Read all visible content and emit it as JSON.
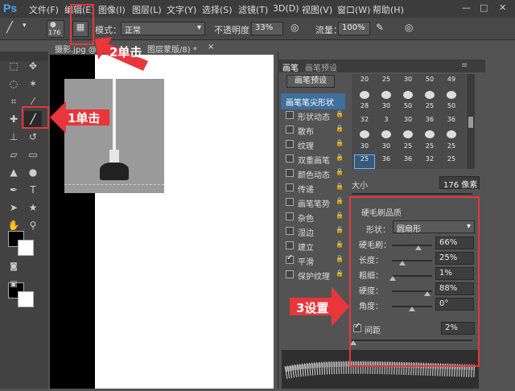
{
  "app": {
    "logo": "Ps"
  },
  "menubar": {
    "items": [
      "文件(F)",
      "编辑(E)",
      "图像(I)",
      "图层(L)",
      "文字(Y)",
      "选择(S)",
      "滤镜(T)",
      "3D(D)",
      "视图(V)",
      "窗口(W)",
      "帮助(H)"
    ],
    "window_controls": [
      "—",
      "□",
      "✕"
    ]
  },
  "options_bar": {
    "brush_size": "176",
    "mode_label": "模式：",
    "mode_value": "正常",
    "opacity_label": "不透明度：",
    "opacity_value": "33%",
    "flow_label": "流量：",
    "flow_value": "100%"
  },
  "document_tab": {
    "title": "摄影.jpg @ 3",
    "title_tail": "图层蒙版/8) *",
    "close": "×"
  },
  "panel": {
    "tabs": [
      "画笔",
      "画笔预设"
    ],
    "preset_button": "画笔预设",
    "options": [
      {
        "label": "画笔笔尖形状",
        "checked": null,
        "selected": true
      },
      {
        "label": "形状动态",
        "checked": false
      },
      {
        "label": "散布",
        "checked": false
      },
      {
        "label": "纹理",
        "checked": false
      },
      {
        "label": "双重画笔",
        "checked": false
      },
      {
        "label": "颜色动态",
        "checked": false
      },
      {
        "label": "传递",
        "checked": false
      },
      {
        "label": "画笔笔势",
        "checked": false
      },
      {
        "label": "杂色",
        "checked": false
      },
      {
        "label": "湿边",
        "checked": false
      },
      {
        "label": "建立",
        "checked": false
      },
      {
        "label": "平滑",
        "checked": true
      },
      {
        "label": "保护纹理",
        "checked": false
      }
    ],
    "brush_sizes": [
      [
        "20",
        "25",
        "30",
        "50",
        "49"
      ],
      [
        "",
        "",
        "",
        "",
        ""
      ],
      [
        "28",
        "30",
        "50",
        "25",
        "50"
      ],
      [
        "32",
        "3",
        "30",
        "36",
        "36"
      ],
      [
        "",
        "",
        "",
        "",
        ""
      ],
      [
        "30",
        "30",
        "25",
        "25",
        "25"
      ],
      [
        "25",
        "36",
        "36",
        "32",
        "25"
      ]
    ],
    "size_label": "大小",
    "size_value": "176 像素",
    "bristle_title": "硬毛刷品质",
    "shape_label": "形状：",
    "shape_value": "圆扇形",
    "params": [
      {
        "label": "硬毛刷：",
        "value": "66%",
        "level": 0.66
      },
      {
        "label": "长度：",
        "value": "25%",
        "level": 0.25
      },
      {
        "label": "粗细：",
        "value": "1%",
        "level": 0.01
      },
      {
        "label": "硬度：",
        "value": "88%",
        "level": 0.88
      },
      {
        "label": "角度：",
        "value": "0°",
        "level": 0.5
      }
    ],
    "spacing_label": "间距",
    "spacing_value": "2%",
    "spacing_checked": true
  },
  "annotations": {
    "step1": "1单击",
    "step2": "2单击",
    "step3": "3设置"
  },
  "colors": {
    "accent": "#e8363a",
    "selected_row": "#3f6f9c"
  }
}
